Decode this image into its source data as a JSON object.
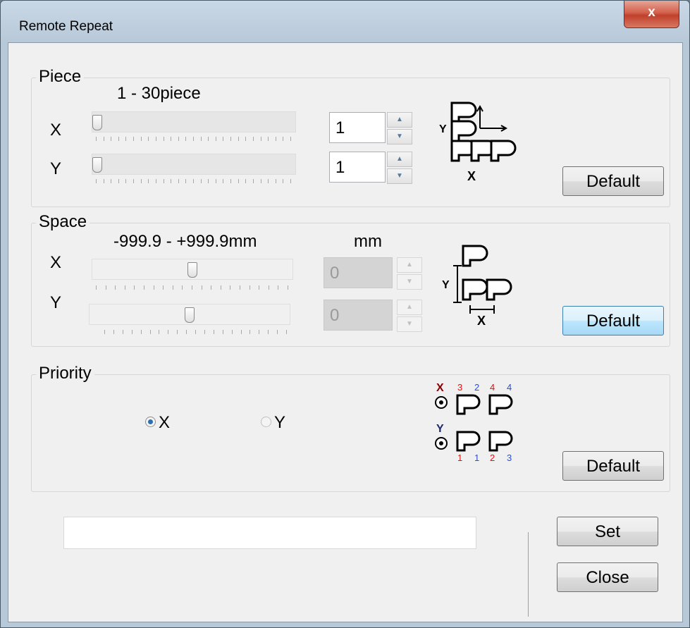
{
  "window": {
    "title": "Remote Repeat",
    "close_symbol": "x"
  },
  "piece": {
    "legend": "Piece",
    "range_label": "1 - 30piece",
    "x_label": "X",
    "y_label": "Y",
    "x_value": "1",
    "y_value": "1",
    "x_slider_position": 0.0,
    "y_slider_position": 0.0,
    "default_label": "Default",
    "diagram": {
      "y_letter": "Y",
      "x_letter": "X",
      "glyph": "P"
    }
  },
  "space": {
    "legend": "Space",
    "range_label": "-999.9 - +999.9mm",
    "unit_label": "mm",
    "x_label": "X",
    "y_label": "Y",
    "x_value": "0",
    "y_value": "0",
    "x_slider_position": 0.5,
    "y_slider_position": 0.5,
    "enabled": false,
    "default_label": "Default",
    "diagram": {
      "y_letter": "Y",
      "x_letter": "X",
      "glyph": "P"
    }
  },
  "priority": {
    "legend": "Priority",
    "options": [
      {
        "label": "X",
        "selected": true
      },
      {
        "label": "Y",
        "selected": false
      }
    ],
    "default_label": "Default",
    "diagram": {
      "x_letter": "X",
      "y_letter": "Y",
      "glyph": "P",
      "top_numbers": [
        "3",
        "2",
        "4",
        "4"
      ],
      "bottom_numbers": [
        "1",
        "1",
        "2",
        "3"
      ]
    }
  },
  "status_text": "",
  "buttons": {
    "set": "Set",
    "close": "Close"
  },
  "colors": {
    "accent_red": "#e01010",
    "accent_blue": "#2a4fd0",
    "x_mark": "#8b0000",
    "y_mark": "#1a2a6c"
  }
}
